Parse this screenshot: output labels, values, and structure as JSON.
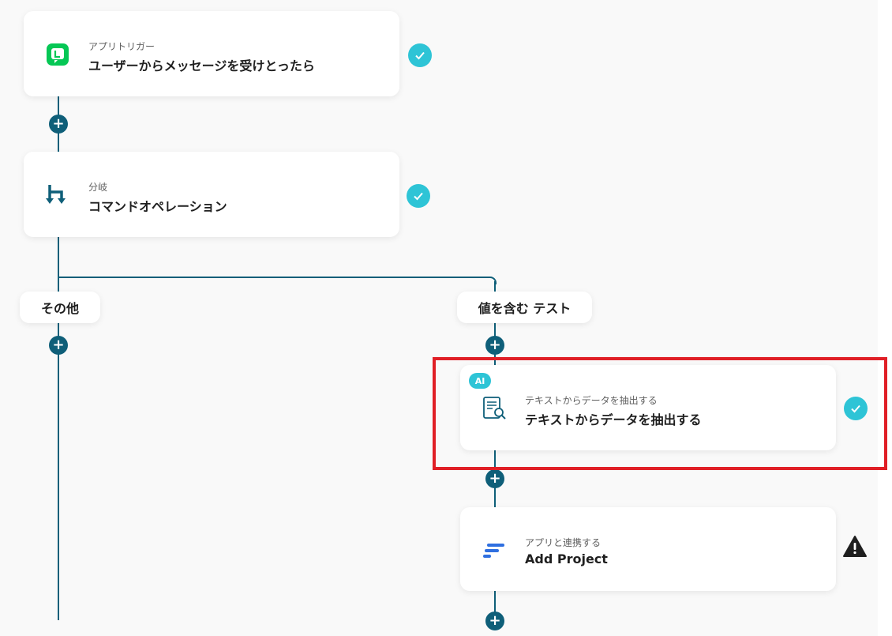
{
  "flow": {
    "nodes": [
      {
        "id": "trigger",
        "subtitle": "アプリトリガー",
        "title": "ユーザーからメッセージを受けとったら",
        "icon": "line-app-icon",
        "status": "complete"
      },
      {
        "id": "branch",
        "subtitle": "分岐",
        "title": "コマンドオペレーション",
        "icon": "branch-icon",
        "status": "complete"
      },
      {
        "id": "ai-extract",
        "badge": "AI",
        "subtitle": "テキストからデータを抽出する",
        "title": "テキストからデータを抽出する",
        "icon": "document-search-icon",
        "status": "complete",
        "highlighted": true
      },
      {
        "id": "add-project",
        "subtitle": "アプリと連携する",
        "title": "Add Project",
        "icon": "app-logo-icon",
        "status": "warning"
      }
    ],
    "branches": {
      "left_label": "その他",
      "right_label": "値を含む テスト"
    },
    "add_step_glyph": "+"
  },
  "colors": {
    "connector": "#0f5f79",
    "check": "#2ec4d6",
    "highlight": "#e01f26",
    "line_green": "#06c755",
    "app_blue": "#2f6fe0",
    "warning": "#1f1f1f"
  }
}
